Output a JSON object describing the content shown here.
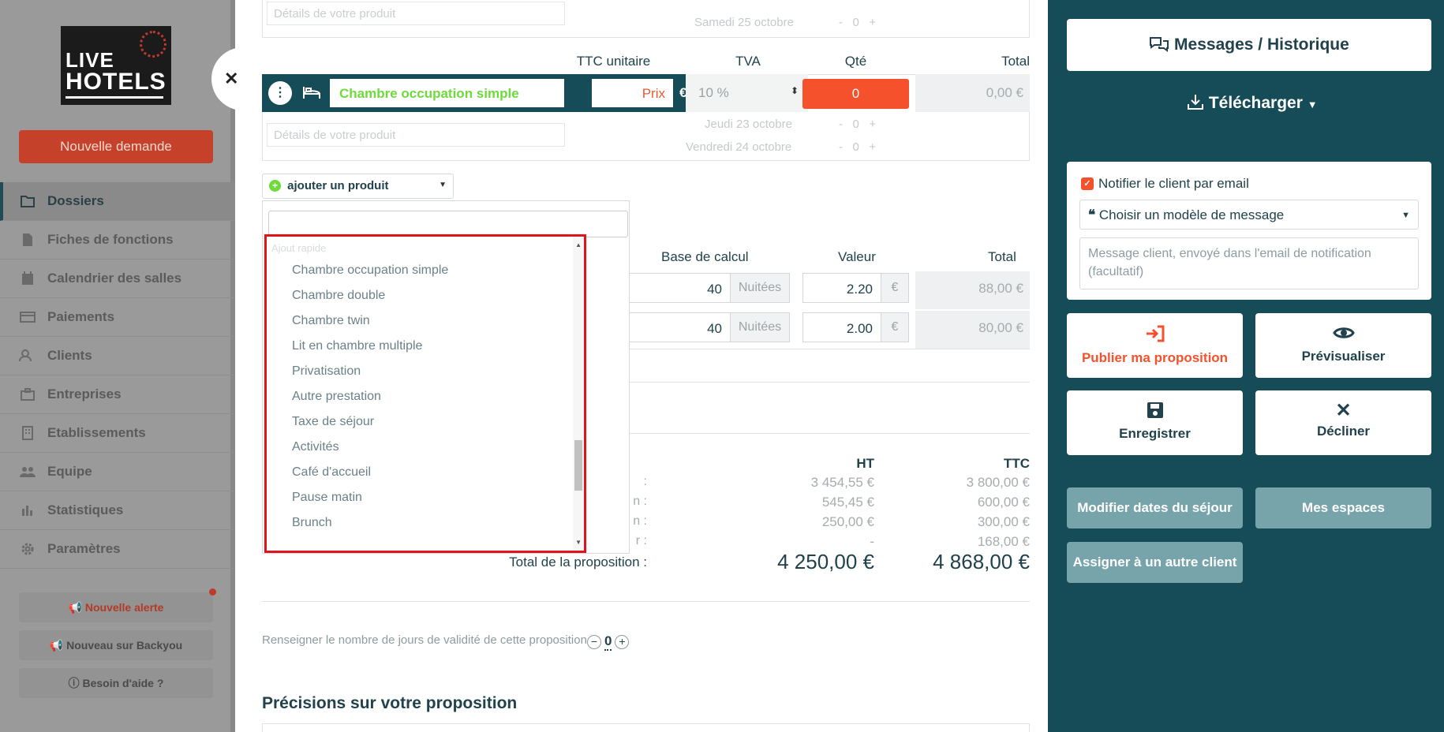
{
  "sidebar": {
    "logo": {
      "line1": "LIVE",
      "line2": "HOTELS"
    },
    "new_request": "Nouvelle demande",
    "items": [
      {
        "label": "Dossiers",
        "icon": "folder-icon",
        "active": true
      },
      {
        "label": "Fiches de fonctions",
        "icon": "file-icon"
      },
      {
        "label": "Calendrier des salles",
        "icon": "calendar-icon"
      },
      {
        "label": "Paiements",
        "icon": "credit-card-icon"
      },
      {
        "label": "Clients",
        "icon": "users-icon"
      },
      {
        "label": "Entreprises",
        "icon": "briefcase-icon"
      },
      {
        "label": "Etablissements",
        "icon": "building-icon"
      },
      {
        "label": "Equipe",
        "icon": "team-icon"
      },
      {
        "label": "Statistiques",
        "icon": "bar-chart-icon"
      },
      {
        "label": "Paramètres",
        "icon": "gear-icon"
      }
    ],
    "alert_btn": "Nouvelle alerte",
    "news_btn": "Nouveau sur Backyou",
    "help_btn": "Besoin d'aide ?"
  },
  "main": {
    "details_placeholder": "Détails de votre produit",
    "date_top": "Samedi 25 octobre",
    "stepper_zero": "0",
    "headers": {
      "ttc": "TTC unitaire",
      "tva": "TVA",
      "qty": "Qté",
      "total": "Total"
    },
    "product": {
      "name": "Chambre occupation simple",
      "price_placeholder": "Prix",
      "currency": "€",
      "tva": "10 %",
      "qty": "0",
      "total": "0,00 €"
    },
    "dates": [
      "Jeudi 23 octobre",
      "Vendredi 24 octobre"
    ],
    "add_product": "ajouter un produit",
    "dropdown": {
      "header": "Ajout rapide",
      "items": [
        "Chambre occupation simple",
        "Chambre double",
        "Chambre twin",
        "Lit en chambre multiple",
        "Privatisation",
        "Autre prestation",
        "Taxe de séjour",
        "Activités",
        "Café d'accueil",
        "Pause matin",
        "Brunch"
      ]
    },
    "tax_headers": {
      "base": "Base de calcul",
      "value": "Valeur",
      "total": "Total"
    },
    "tax_rows": [
      {
        "base": "40",
        "unit": "Nuitées",
        "value": "2.20",
        "currency": "€",
        "total": "88,00 €"
      },
      {
        "base": "40",
        "unit": "Nuitées",
        "value": "2.00",
        "currency": "€",
        "total": "80,00 €"
      }
    ],
    "summary": {
      "ht": "HT",
      "ttc": "TTC",
      "rows": [
        {
          "label": ":",
          "ht": "3 454,55 €",
          "ttc": "3 800,00 €"
        },
        {
          "label": "n :",
          "ht": "545,45 €",
          "ttc": "600,00 €"
        },
        {
          "label": "n :",
          "ht": "250,00 €",
          "ttc": "300,00 €"
        },
        {
          "label": "r :",
          "ht": "-",
          "ttc": "168,00 €"
        }
      ],
      "total_label": "Total de la proposition :",
      "total_ht": "4 250,00 €",
      "total_ttc": "4 868,00 €"
    },
    "validity_text": "Renseigner le nombre de jours de validité de cette proposition",
    "validity_value": "0",
    "precisions_title": "Précisions sur votre proposition"
  },
  "right": {
    "messages_btn": "Messages / Historique",
    "download": "Télécharger",
    "notify_label": "Notifier le client par email",
    "model_select": "Choisir un modèle de message",
    "message_placeholder": "Message client, envoyé dans l'email de notification (facultatif)",
    "publish": "Publier ma proposition",
    "preview": "Prévisualiser",
    "save": "Enregistrer",
    "decline": "Décliner",
    "modify_dates": "Modifier dates du séjour",
    "my_spaces": "Mes espaces",
    "assign": "Assigner à un autre client"
  }
}
